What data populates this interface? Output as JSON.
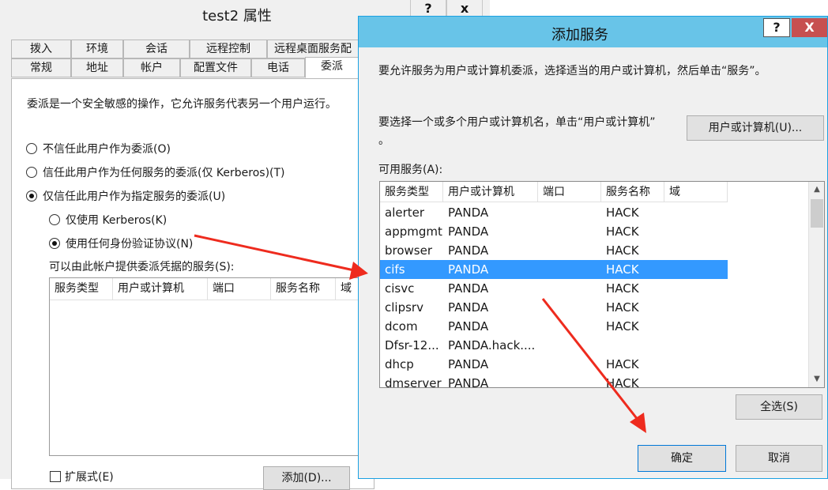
{
  "background_window": {
    "title": "test2 属性",
    "controls": {
      "help": "?",
      "close": "x"
    },
    "tabs_row1": [
      "拨入",
      "环境",
      "会话",
      "远程控制",
      "远程桌面服务配"
    ],
    "tabs_row2": [
      "常规",
      "地址",
      "帐户",
      "配置文件",
      "电话",
      "委派"
    ],
    "active_tab": "委派",
    "description": "委派是一个安全敏感的操作，它允许服务代表另一个用户运行。",
    "radio_options": [
      {
        "label": "不信任此用户作为委派(O)",
        "checked": false
      },
      {
        "label": "信任此用户作为任何服务的委派(仅 Kerberos)(T)",
        "checked": false
      },
      {
        "label": "仅信任此用户作为指定服务的委派(U)",
        "checked": true
      }
    ],
    "sub_radio_options": [
      {
        "label": "仅使用 Kerberos(K)",
        "checked": false
      },
      {
        "label": "使用任何身份验证协议(N)",
        "checked": true
      }
    ],
    "services_label": "可以由此帐户提供委派凭据的服务(S):",
    "list_columns": [
      "服务类型",
      "用户或计算机",
      "端口",
      "服务名称",
      "域"
    ],
    "expanded_label": "扩展式(E)",
    "add_button": "添加(D)..."
  },
  "dialog": {
    "title": "添加服务",
    "help_icon": "?",
    "close_icon": "X",
    "instruction": "要允许服务为用户或计算机委派，选择适当的用户或计算机，然后单击“服务”。",
    "select_prompt_line1": "要选择一个或多个用户或计算机名，单击“用户或计算机”",
    "select_prompt_line2": "。",
    "user_computer_button": "用户或计算机(U)...",
    "available_label": "可用服务(A):",
    "columns": [
      "服务类型",
      "用户或计算机",
      "端口",
      "服务名称",
      "域"
    ],
    "rows": [
      {
        "type": "alerter",
        "host": "PANDA",
        "port": "",
        "name": "HACK",
        "domain": ""
      },
      {
        "type": "appmgmt",
        "host": "PANDA",
        "port": "",
        "name": "HACK",
        "domain": ""
      },
      {
        "type": "browser",
        "host": "PANDA",
        "port": "",
        "name": "HACK",
        "domain": ""
      },
      {
        "type": "cifs",
        "host": "PANDA",
        "port": "",
        "name": "HACK",
        "domain": "",
        "selected": true
      },
      {
        "type": "cisvc",
        "host": "PANDA",
        "port": "",
        "name": "HACK",
        "domain": ""
      },
      {
        "type": "clipsrv",
        "host": "PANDA",
        "port": "",
        "name": "HACK",
        "domain": ""
      },
      {
        "type": "dcom",
        "host": "PANDA",
        "port": "",
        "name": "HACK",
        "domain": ""
      },
      {
        "type": "Dfsr-12...",
        "host": "PANDA.hack....",
        "port": "",
        "name": "",
        "domain": ""
      },
      {
        "type": "dhcp",
        "host": "PANDA",
        "port": "",
        "name": "HACK",
        "domain": ""
      },
      {
        "type": "dmserver",
        "host": "PANDA",
        "port": "",
        "name": "HACK",
        "domain": ""
      }
    ],
    "select_all_button": "全选(S)",
    "ok_button": "确定",
    "cancel_button": "取消"
  },
  "colors": {
    "dialog_title_bar": "#68c4e8",
    "selection": "#3399ff",
    "close_button": "#c75050",
    "annotation_arrow": "#ee2b1e"
  }
}
